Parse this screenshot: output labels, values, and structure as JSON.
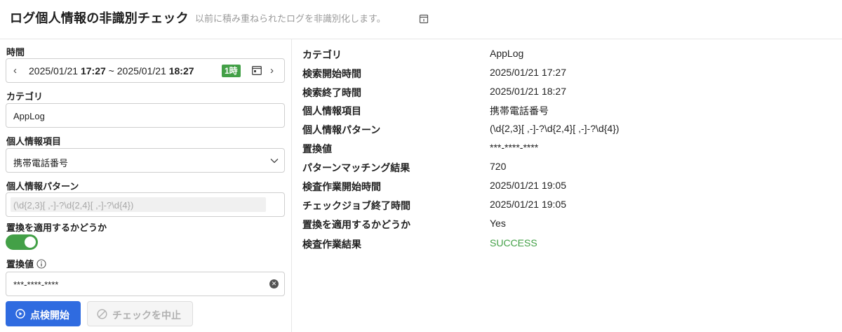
{
  "header": {
    "title": "ログ個人情報の非識別チェック",
    "subtitle": "以前に積み重ねられたログを非識別化します。",
    "icon": "archive-icon"
  },
  "form": {
    "time": {
      "label": "時間",
      "start_date": "2025/01/21",
      "start_time": "17:27",
      "separator": "~",
      "end_date": "2025/01/21",
      "end_time": "18:27",
      "duration_badge": "1時",
      "badge_color": "#43a047"
    },
    "category": {
      "label": "カテゴリ",
      "value": "AppLog"
    },
    "pii_item": {
      "label": "個人情報項目",
      "value": "携帯電話番号"
    },
    "pii_pattern": {
      "label": "個人情報パターン",
      "value": "(\\d{2,3}[ ,-]-?\\d{2,4}[ ,-]-?\\d{4})"
    },
    "apply_replace": {
      "label": "置換を適用するかどうか",
      "enabled": true
    },
    "replace_value": {
      "label": "置換値",
      "value": "***-****-****"
    },
    "buttons": {
      "start": "点検開始",
      "stop": "チェックを中止",
      "primary_color": "#2f6be0"
    }
  },
  "details": {
    "rows": [
      {
        "key": "カテゴリ",
        "value": "AppLog"
      },
      {
        "key": "検索開始時間",
        "value": "2025/01/21 17:27"
      },
      {
        "key": "検索終了時間",
        "value": "2025/01/21 18:27"
      },
      {
        "key": "個人情報項目",
        "value": "携帯電話番号"
      },
      {
        "key": "個人情報パターン",
        "value": "(\\d{2,3}[ ,-]-?\\d{2,4}[ ,-]-?\\d{4})"
      },
      {
        "key": "置換値",
        "value": "***-****-****"
      },
      {
        "key": "パターンマッチング結果",
        "value": "720"
      },
      {
        "key": "検査作業開始時間",
        "value": "2025/01/21 19:05"
      },
      {
        "key": "チェックジョブ終了時間",
        "value": "2025/01/21 19:05"
      },
      {
        "key": "置換を適用するかどうか",
        "value": "Yes"
      },
      {
        "key": "検査作業結果",
        "value": "SUCCESS"
      }
    ],
    "success_color": "#43a047"
  }
}
